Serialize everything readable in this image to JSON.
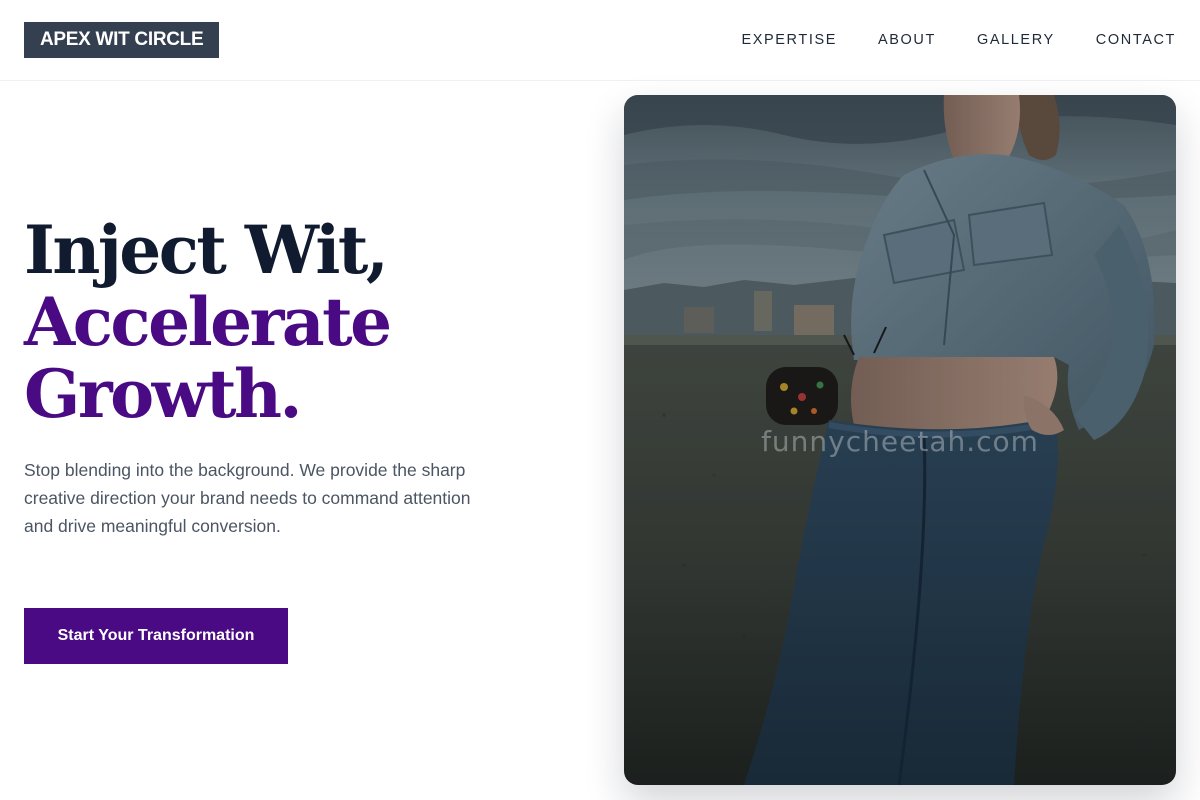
{
  "brand": {
    "name": "APEX WIT CIRCLE"
  },
  "nav": {
    "items": [
      {
        "label": "EXPERTISE"
      },
      {
        "label": "ABOUT"
      },
      {
        "label": "GALLERY"
      },
      {
        "label": "CONTACT"
      }
    ]
  },
  "hero": {
    "headline": {
      "line1": "Inject Wit,",
      "line2": "Accelerate",
      "line3": "Growth."
    },
    "subtext": "Stop blending into the background. We provide the sharp creative direction your brand needs to command attention and drive meaningful conversion.",
    "cta_label": "Start Your Transformation",
    "image": {
      "watermark": "funnycheetah.com"
    }
  },
  "colors": {
    "brand_dark": "#344050",
    "accent_purple": "#4a0a84",
    "headline_dark": "#111b30",
    "body_text": "#4b5563"
  }
}
